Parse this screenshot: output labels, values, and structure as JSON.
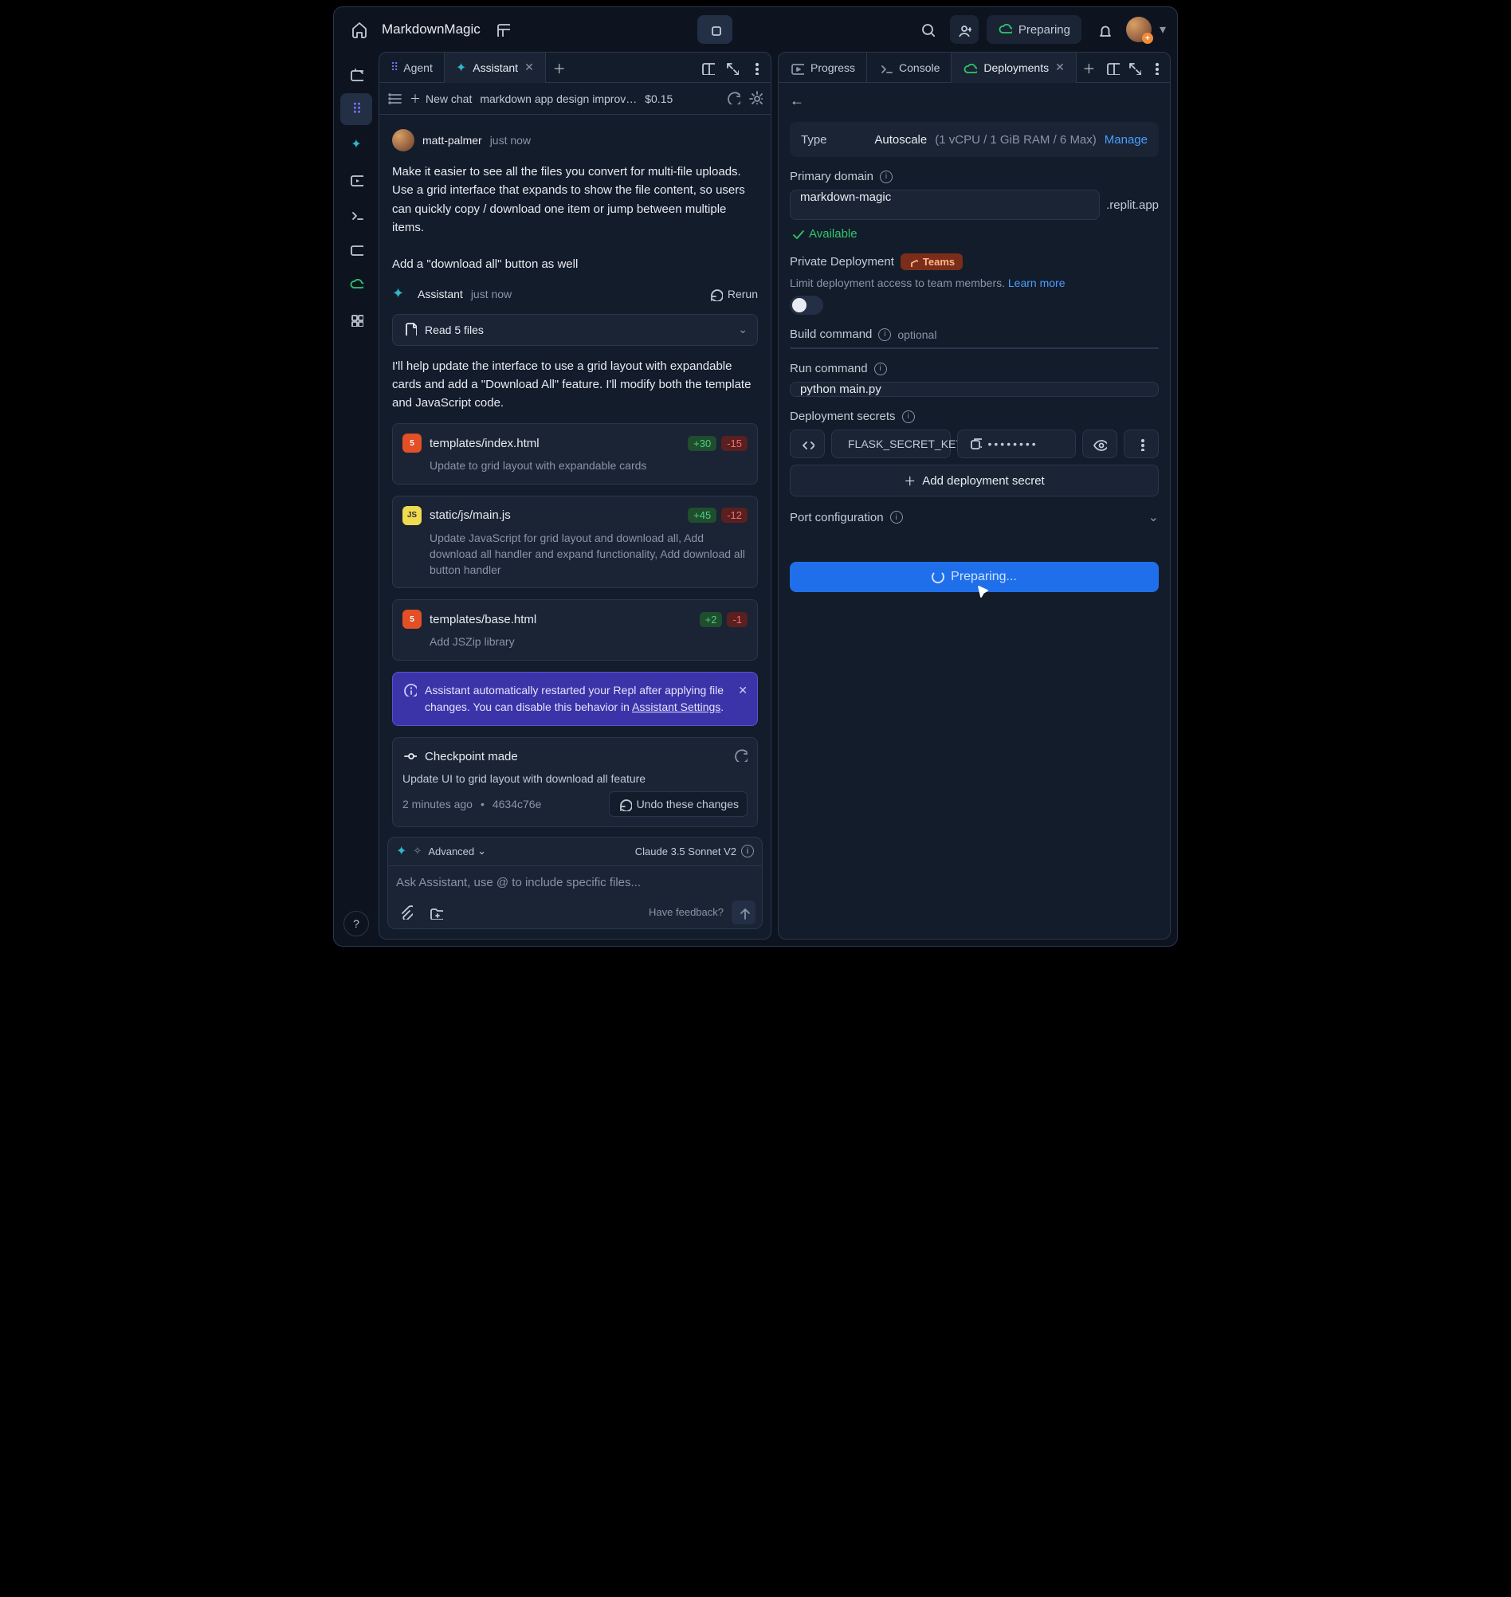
{
  "project_name": "MarkdownMagic",
  "top_status": "Preparing",
  "left_tabs": [
    {
      "label": "Agent",
      "icon": "agent-dots"
    },
    {
      "label": "Assistant",
      "icon": "assistant-dot",
      "closable": true,
      "active": true
    }
  ],
  "right_tabs": [
    {
      "label": "Progress",
      "icon": "progress-dot"
    },
    {
      "label": "Console",
      "icon": "console-dot"
    },
    {
      "label": "Deployments",
      "icon": "deploy-dot",
      "closable": true,
      "active": true
    }
  ],
  "chat_header": {
    "new_chat": "New chat",
    "convo_name": "markdown app design improv…",
    "price": "$0.15"
  },
  "user_msg": {
    "name": "matt-palmer",
    "time": "just now",
    "text": "Make it easier to see all the files you convert for multi-file uploads. Use a grid interface that expands to show the file content, so users can quickly copy / download one item or jump between multiple items.\n\nAdd a \"download all\" button as well"
  },
  "assistant_header": {
    "name": "Assistant",
    "time": "just now",
    "rerun": "Rerun"
  },
  "read_files": "Read 5 files",
  "assistant_intro": "I'll help update the interface to use a grid layout with expandable cards and add a \"Download All\" feature. I'll modify both the template and JavaScript code.",
  "files": [
    {
      "badge": "HTML",
      "name": "templates/index.html",
      "plus": "+30",
      "minus": "-15",
      "desc": "Update to grid layout with expandable cards"
    },
    {
      "badge": "JS",
      "name": "static/js/main.js",
      "plus": "+45",
      "minus": "-12",
      "desc": "Update JavaScript for grid layout and download all, Add download all handler and expand functionality, Add download all button handler"
    },
    {
      "badge": "HTML",
      "name": "templates/base.html",
      "plus": "+2",
      "minus": "-1",
      "desc": "Add JSZip library"
    }
  ],
  "info_text_pre": "Assistant automatically restarted your Repl after applying file changes. You can disable this behavior in ",
  "info_link": "Assistant Settings",
  "info_text_post": ".",
  "checkpoint": {
    "title": "Checkpoint made",
    "msg": "Update UI to grid layout with download all feature",
    "time": "2 minutes ago",
    "sha": "4634c76e",
    "undo": "Undo these changes"
  },
  "composer": {
    "advanced": "Advanced",
    "model": "Claude 3.5 Sonnet V2",
    "placeholder": "Ask Assistant, use @ to include specific files...",
    "feedback": "Have feedback?"
  },
  "deploy": {
    "type_label": "Type",
    "type_value": "Autoscale",
    "type_sub": "(1 vCPU / 1 GiB RAM / 6 Max)",
    "manage": "Manage",
    "primary_domain_label": "Primary domain",
    "primary_domain_value": "markdown-magic",
    "tld": ".replit.app",
    "available": "Available",
    "private_label": "Private Deployment",
    "teams": "Teams",
    "private_sub": "Limit deployment access to team members. ",
    "learn_more": "Learn more",
    "build_label": "Build command",
    "optional": "optional",
    "build_value": "",
    "run_label": "Run command",
    "run_value": "python main.py",
    "secrets_label": "Deployment secrets",
    "secret_key": "FLASK_SECRET_KEY",
    "secret_masked": "••••••••",
    "add_secret": "Add deployment secret",
    "port_label": "Port configuration",
    "deploy_btn": "Preparing..."
  }
}
